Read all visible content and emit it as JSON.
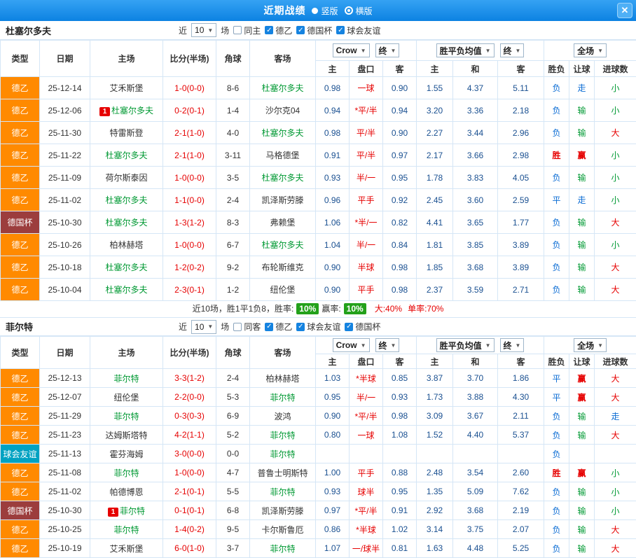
{
  "colors": {
    "topbar_blue": "#0c82e2",
    "table_border": "#d5e6f6",
    "focus_team_green": "#009933",
    "score_red": "#e60000",
    "odds_navy": "#1a5091",
    "handicap_red": "#e60000",
    "type_league_orange": "#ff8a00",
    "type_cup_maroon": "#9c3d3d",
    "type_friendly_teal": "#00a2c2",
    "win_red": "#e60000",
    "neutral_blue": "#0b6cd4",
    "lose_green": "#009933",
    "rate_badge_green": "#23a11b"
  },
  "topbar": {
    "title": "近期战绩",
    "radios": [
      {
        "label": "竖版",
        "selected": false
      },
      {
        "label": "横版",
        "selected": true
      }
    ],
    "close_icon": "✕"
  },
  "table_header": {
    "static_cols": [
      "类型",
      "日期",
      "主场",
      "比分(半场)",
      "角球",
      "客场"
    ],
    "dropdowns": {
      "company": "Crow",
      "company_final": "终",
      "europe": "胜平负均值",
      "europe_final": "终",
      "scope": "全场"
    },
    "sub_cols": [
      "主",
      "盘口",
      "客",
      "主",
      "和",
      "客",
      "胜负",
      "让球",
      "进球数"
    ]
  },
  "sections": [
    {
      "team": "杜塞尔多夫",
      "filter": {
        "near_label": "近",
        "count": "10",
        "games_label": "场",
        "checkboxes": [
          {
            "label": "同主",
            "checked": false
          },
          {
            "label": "德乙",
            "checked": true
          },
          {
            "label": "德国杯",
            "checked": true
          },
          {
            "label": "球会友谊",
            "checked": true
          }
        ]
      },
      "rows": [
        {
          "type": "德乙",
          "date": "25-12-14",
          "home": "艾禾斯堡",
          "home_focus": false,
          "score": "1-0(0-0)",
          "corners": "8-6",
          "away": "杜塞尔多夫",
          "away_focus": true,
          "odds": [
            "0.98",
            "一球",
            "0.90"
          ],
          "europe": [
            "1.55",
            "4.37",
            "5.11"
          ],
          "wdl": "负",
          "handicap": "走",
          "goals": "小"
        },
        {
          "type": "德乙",
          "date": "25-12-06",
          "home": "杜塞尔多夫",
          "home_focus": true,
          "home_badge": "1",
          "score": "0-2(0-1)",
          "corners": "1-4",
          "away": "沙尔克04",
          "away_focus": false,
          "odds": [
            "0.94",
            "*平/半",
            "0.94"
          ],
          "europe": [
            "3.20",
            "3.36",
            "2.18"
          ],
          "wdl": "负",
          "handicap": "输",
          "goals": "小"
        },
        {
          "type": "德乙",
          "date": "25-11-30",
          "home": "特雷斯登",
          "home_focus": false,
          "score": "2-1(1-0)",
          "corners": "4-0",
          "away": "杜塞尔多夫",
          "away_focus": true,
          "odds": [
            "0.98",
            "平/半",
            "0.90"
          ],
          "europe": [
            "2.27",
            "3.44",
            "2.96"
          ],
          "wdl": "负",
          "handicap": "输",
          "goals": "大"
        },
        {
          "type": "德乙",
          "date": "25-11-22",
          "home": "杜塞尔多夫",
          "home_focus": true,
          "score": "2-1(1-0)",
          "corners": "3-11",
          "away": "马格德堡",
          "away_focus": false,
          "odds": [
            "0.91",
            "平/半",
            "0.97"
          ],
          "europe": [
            "2.17",
            "3.66",
            "2.98"
          ],
          "wdl": "胜",
          "handicap": "赢",
          "goals": "小"
        },
        {
          "type": "德乙",
          "date": "25-11-09",
          "home": "荷尔斯泰因",
          "home_focus": false,
          "score": "1-0(0-0)",
          "corners": "3-5",
          "away": "杜塞尔多夫",
          "away_focus": true,
          "odds": [
            "0.93",
            "半/一",
            "0.95"
          ],
          "europe": [
            "1.78",
            "3.83",
            "4.05"
          ],
          "wdl": "负",
          "handicap": "输",
          "goals": "小"
        },
        {
          "type": "德乙",
          "date": "25-11-02",
          "home": "杜塞尔多夫",
          "home_focus": true,
          "score": "1-1(0-0)",
          "corners": "2-4",
          "away": "凯泽斯劳滕",
          "away_focus": false,
          "odds": [
            "0.96",
            "平手",
            "0.92"
          ],
          "europe": [
            "2.45",
            "3.60",
            "2.59"
          ],
          "wdl": "平",
          "handicap": "走",
          "goals": "小"
        },
        {
          "type": "德国杯",
          "date": "25-10-30",
          "home": "杜塞尔多夫",
          "home_focus": true,
          "score": "1-3(1-2)",
          "corners": "8-3",
          "away": "弗赖堡",
          "away_focus": false,
          "odds": [
            "1.06",
            "*半/一",
            "0.82"
          ],
          "europe": [
            "4.41",
            "3.65",
            "1.77"
          ],
          "wdl": "负",
          "handicap": "输",
          "goals": "大"
        },
        {
          "type": "德乙",
          "date": "25-10-26",
          "home": "柏林赫塔",
          "home_focus": false,
          "score": "1-0(0-0)",
          "corners": "6-7",
          "away": "杜塞尔多夫",
          "away_focus": true,
          "odds": [
            "1.04",
            "半/一",
            "0.84"
          ],
          "europe": [
            "1.81",
            "3.85",
            "3.89"
          ],
          "wdl": "负",
          "handicap": "输",
          "goals": "小"
        },
        {
          "type": "德乙",
          "date": "25-10-18",
          "home": "杜塞尔多夫",
          "home_focus": true,
          "score": "1-2(0-2)",
          "corners": "9-2",
          "away": "布轮斯维克",
          "away_focus": false,
          "odds": [
            "0.90",
            "半球",
            "0.98"
          ],
          "europe": [
            "1.85",
            "3.68",
            "3.89"
          ],
          "wdl": "负",
          "handicap": "输",
          "goals": "大"
        },
        {
          "type": "德乙",
          "date": "25-10-04",
          "home": "杜塞尔多夫",
          "home_focus": true,
          "score": "2-3(0-1)",
          "corners": "1-2",
          "away": "纽伦堡",
          "away_focus": false,
          "odds": [
            "0.90",
            "平手",
            "0.98"
          ],
          "europe": [
            "2.37",
            "3.59",
            "2.71"
          ],
          "wdl": "负",
          "handicap": "输",
          "goals": "大"
        }
      ],
      "summary": {
        "prefix": "近10场，胜1平1负8，胜率:",
        "win_rate": "10%",
        "mid": "赢率:",
        "profit_rate": "10%",
        "big": "大:40%",
        "single": "单率:70%"
      }
    },
    {
      "team": "菲尔特",
      "filter": {
        "near_label": "近",
        "count": "10",
        "games_label": "场",
        "checkboxes": [
          {
            "label": "同客",
            "checked": false
          },
          {
            "label": "德乙",
            "checked": true
          },
          {
            "label": "球会友谊",
            "checked": true
          },
          {
            "label": "德国杯",
            "checked": true
          }
        ]
      },
      "rows": [
        {
          "type": "德乙",
          "date": "25-12-13",
          "home": "菲尔特",
          "home_focus": true,
          "score": "3-3(1-2)",
          "corners": "2-4",
          "away": "柏林赫塔",
          "away_focus": false,
          "odds": [
            "1.03",
            "*半球",
            "0.85"
          ],
          "europe": [
            "3.87",
            "3.70",
            "1.86"
          ],
          "wdl": "平",
          "handicap": "赢",
          "goals": "大"
        },
        {
          "type": "德乙",
          "date": "25-12-07",
          "home": "纽伦堡",
          "home_focus": false,
          "score": "2-2(0-0)",
          "corners": "5-3",
          "away": "菲尔特",
          "away_focus": true,
          "odds": [
            "0.95",
            "半/一",
            "0.93"
          ],
          "europe": [
            "1.73",
            "3.88",
            "4.30"
          ],
          "wdl": "平",
          "handicap": "赢",
          "goals": "大"
        },
        {
          "type": "德乙",
          "date": "25-11-29",
          "home": "菲尔特",
          "home_focus": true,
          "score": "0-3(0-3)",
          "corners": "6-9",
          "away": "波鸿",
          "away_focus": false,
          "odds": [
            "0.90",
            "*平/半",
            "0.98"
          ],
          "europe": [
            "3.09",
            "3.67",
            "2.11"
          ],
          "wdl": "负",
          "handicap": "输",
          "goals": "走"
        },
        {
          "type": "德乙",
          "date": "25-11-23",
          "home": "达姆斯塔特",
          "home_focus": false,
          "score": "4-2(1-1)",
          "corners": "5-2",
          "away": "菲尔特",
          "away_focus": true,
          "odds": [
            "0.80",
            "一球",
            "1.08"
          ],
          "europe": [
            "1.52",
            "4.40",
            "5.37"
          ],
          "wdl": "负",
          "handicap": "输",
          "goals": "大"
        },
        {
          "type": "球会友谊",
          "date": "25-11-13",
          "home": "霍芬海姆",
          "home_focus": false,
          "score": "3-0(0-0)",
          "corners": "0-0",
          "away": "菲尔特",
          "away_focus": true,
          "odds": [
            "",
            "",
            ""
          ],
          "europe": [
            "",
            "",
            ""
          ],
          "wdl": "负",
          "handicap": "",
          "goals": ""
        },
        {
          "type": "德乙",
          "date": "25-11-08",
          "home": "菲尔特",
          "home_focus": true,
          "score": "1-0(0-0)",
          "corners": "4-7",
          "away": "普鲁士明斯特",
          "away_focus": false,
          "odds": [
            "1.00",
            "平手",
            "0.88"
          ],
          "europe": [
            "2.48",
            "3.54",
            "2.60"
          ],
          "wdl": "胜",
          "handicap": "赢",
          "goals": "小"
        },
        {
          "type": "德乙",
          "date": "25-11-02",
          "home": "帕德博恩",
          "home_focus": false,
          "score": "2-1(0-1)",
          "corners": "5-5",
          "away": "菲尔特",
          "away_focus": true,
          "odds": [
            "0.93",
            "球半",
            "0.95"
          ],
          "europe": [
            "1.35",
            "5.09",
            "7.62"
          ],
          "wdl": "负",
          "handicap": "输",
          "goals": "小"
        },
        {
          "type": "德国杯",
          "date": "25-10-30",
          "home": "菲尔特",
          "home_focus": true,
          "home_badge": "1",
          "score": "0-1(0-1)",
          "corners": "6-8",
          "away": "凯泽斯劳滕",
          "away_focus": false,
          "odds": [
            "0.97",
            "*平/半",
            "0.91"
          ],
          "europe": [
            "2.92",
            "3.68",
            "2.19"
          ],
          "wdl": "负",
          "handicap": "输",
          "goals": "小"
        },
        {
          "type": "德乙",
          "date": "25-10-25",
          "home": "菲尔特",
          "home_focus": true,
          "score": "1-4(0-2)",
          "corners": "9-5",
          "away": "卡尔斯鲁厄",
          "away_focus": false,
          "odds": [
            "0.86",
            "*半球",
            "1.02"
          ],
          "europe": [
            "3.14",
            "3.75",
            "2.07"
          ],
          "wdl": "负",
          "handicap": "输",
          "goals": "大"
        },
        {
          "type": "德乙",
          "date": "25-10-19",
          "home": "艾禾斯堡",
          "home_focus": false,
          "score": "6-0(1-0)",
          "corners": "3-7",
          "away": "菲尔特",
          "away_focus": true,
          "odds": [
            "1.07",
            "一/球半",
            "0.81"
          ],
          "europe": [
            "1.63",
            "4.48",
            "5.25"
          ],
          "wdl": "负",
          "handicap": "输",
          "goals": "大"
        }
      ]
    }
  ]
}
